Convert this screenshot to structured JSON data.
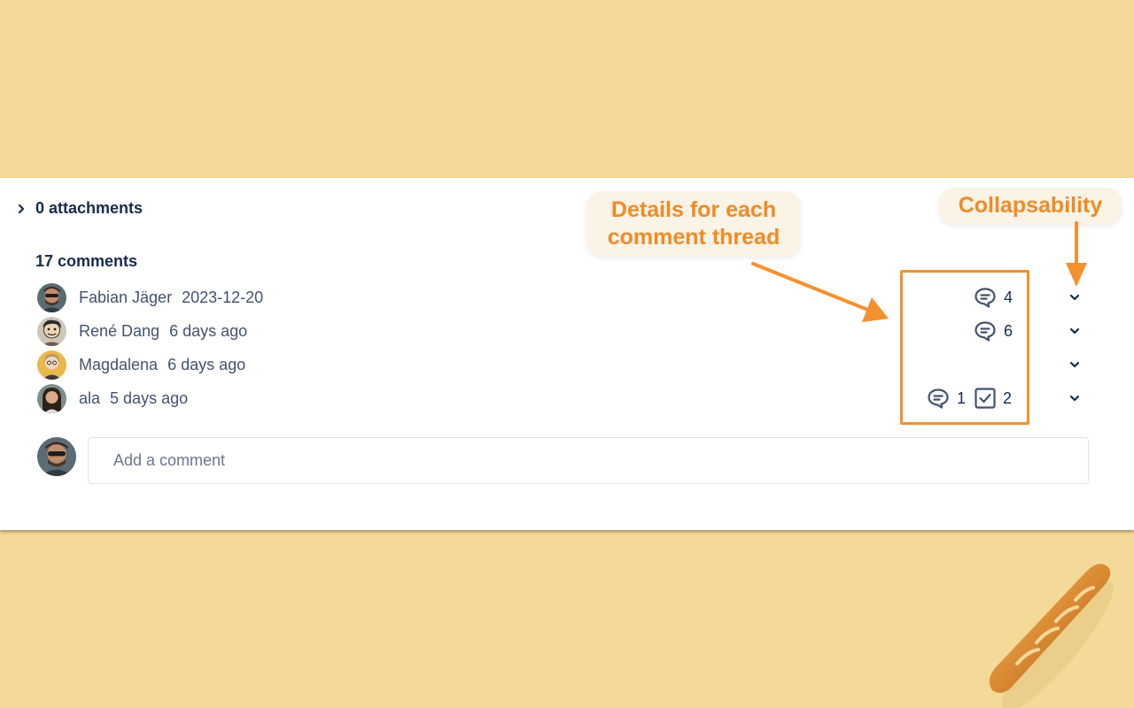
{
  "attachments": {
    "label": "0 attachments"
  },
  "comments": {
    "title": "17 comments",
    "rows": [
      {
        "author": "Fabian Jäger",
        "date": "2023-12-20",
        "comment_count": "4",
        "task_count": ""
      },
      {
        "author": "René Dang",
        "date": "6 days ago",
        "comment_count": "6",
        "task_count": ""
      },
      {
        "author": "Magdalena",
        "date": "6 days ago",
        "comment_count": "",
        "task_count": ""
      },
      {
        "author": "ala",
        "date": "5 days ago",
        "comment_count": "1",
        "task_count": "2"
      }
    ]
  },
  "add_comment": {
    "placeholder": "Add a comment"
  },
  "annotations": {
    "details_line1": "Details for each",
    "details_line2": "comment thread",
    "collapsability": "Collapsability"
  },
  "icons": {
    "attachments_toggle": "chevron-right-icon",
    "thread_toggle": "chevron-down-icon",
    "comment_stat": "speech-bubble-icon",
    "task_stat": "checkbox-icon",
    "decoration": "baguette-icon"
  },
  "colors": {
    "background": "#f4d998",
    "panel": "#ffffff",
    "text_dark": "#172b4d",
    "text_muted": "#42526e",
    "accent_orange": "#f4912f",
    "callout_bg": "#fbf3e6"
  }
}
